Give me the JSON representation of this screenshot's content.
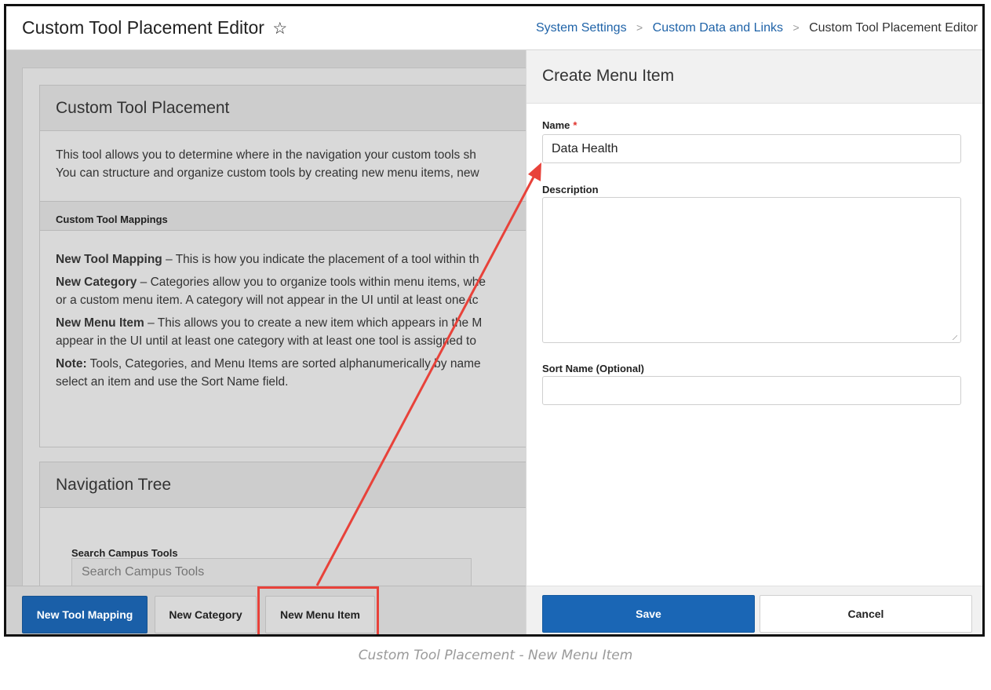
{
  "header": {
    "title": "Custom Tool Placement Editor",
    "breadcrumb": [
      "System Settings",
      "Custom Data and Links",
      "Custom Tool Placement Editor"
    ]
  },
  "placement_card": {
    "title": "Custom Tool Placement",
    "intro_line1": "This tool allows you to determine where in the navigation your custom tools sh",
    "intro_line2": "You can structure and organize custom tools by creating new menu items, new",
    "mappings_heading": "Custom Tool Mappings",
    "items": [
      {
        "term": "New Tool Mapping",
        "line1": " – This is how you indicate the placement of a tool within th",
        "line2": ""
      },
      {
        "term": "New Category",
        "line1": " – Categories allow you to organize tools within menu items, whe",
        "line2": "or a custom menu item. A category will not appear in the UI until at least one tc"
      },
      {
        "term": "New Menu Item",
        "line1": " – This allows you to create a new item which appears in the M",
        "line2": "appear in the UI until at least one category with at least one tool is assigned to"
      },
      {
        "term": "Note:",
        "line1": " Tools, Categories, and Menu Items are sorted alphanumerically by name",
        "line2": "select an item and use the Sort Name field."
      }
    ]
  },
  "nav_tree": {
    "title": "Navigation Tree",
    "search_label": "Search Campus Tools",
    "search_placeholder": "Search Campus Tools"
  },
  "bottom_bar": {
    "new_tool_mapping": "New Tool Mapping",
    "new_category": "New Category",
    "new_menu_item": "New Menu Item"
  },
  "panel": {
    "title": "Create Menu Item",
    "name_label": "Name",
    "required_mark": "*",
    "name_value": "Data Health",
    "description_label": "Description",
    "description_value": "",
    "sort_name_label": "Sort Name (Optional)",
    "sort_name_value": "",
    "save": "Save",
    "cancel": "Cancel"
  },
  "caption": "Custom Tool Placement - New Menu Item",
  "colors": {
    "primary": "#1a66b5",
    "link": "#1f63a8",
    "annotation": "#e8423a"
  }
}
